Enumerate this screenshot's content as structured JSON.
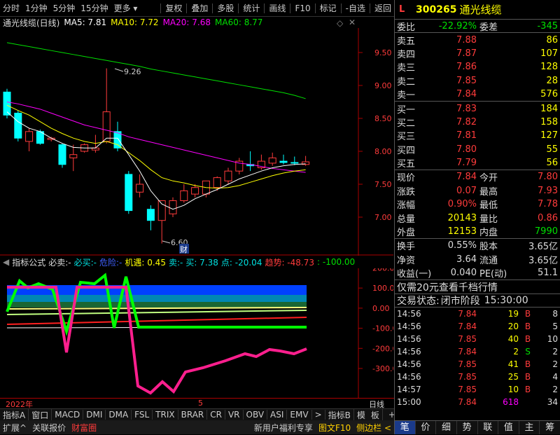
{
  "toolbar": {
    "left": [
      "分时",
      "1分钟",
      "5分钟",
      "15分钟",
      "更多"
    ],
    "right": [
      "复权",
      "叠加",
      "多股",
      "统计",
      "画线",
      "F10",
      "标记",
      "-自选",
      "返回"
    ]
  },
  "chart": {
    "title": "通光线缆(日线)",
    "ma5": "MA5: 7.81",
    "ma10": "MA10: 7.72",
    "ma20": "MA20: 7.68",
    "ma60": "MA60: 8.77",
    "high_label": "9.26",
    "low_label": "6.60",
    "cai_label": "财",
    "y_ticks": [
      "9.50",
      "9.00",
      "8.50",
      "8.00",
      "7.50",
      "7.00"
    ],
    "colors": {
      "up": "#ff3b3b",
      "down": "#00ffff",
      "ma5": "#ffffff",
      "ma10": "#ffff00",
      "ma20": "#ff00ff",
      "ma60": "#00e000"
    }
  },
  "indicator": {
    "name": "指标公式",
    "bibuy": "必卖:-",
    "bisell": "必买:-",
    "weixian": "危险:-",
    "jiyu": "机遇: 0.45",
    "mai": "卖:-",
    "mai2": "买: 7.38",
    "dian": "点: -20.04",
    "qushi": "趋势: -48.73",
    "val": ": -100.00",
    "y_ticks": [
      "200.0",
      "100.0",
      "0.00",
      "-100.0",
      "-200.0",
      "-300.0"
    ]
  },
  "date_axis": {
    "year": "2022年",
    "month": "5",
    "period": "日线"
  },
  "bottom_tabs": [
    "指标A",
    "窗口",
    "MACD",
    "DMI",
    "DMA",
    "FSL",
    "TRIX",
    "BRAR",
    "CR",
    "VR",
    "OBV",
    "ASI",
    "EMV",
    ">",
    "指标B",
    "模",
    "板",
    "+",
    "-"
  ],
  "status_left": [
    "扩展^",
    "关联报价",
    "财富圈"
  ],
  "status_right": [
    "新用户福利专享",
    "图文F10",
    "侧边栏 <"
  ],
  "quote": {
    "prefix": "L",
    "code": "300265",
    "name": "通光线缆",
    "weibi_label": "委比",
    "weibi": "-22.92%",
    "weicha_label": "委差",
    "weicha": "-345",
    "asks": [
      {
        "label": "卖五",
        "price": "7.88",
        "vol": "86"
      },
      {
        "label": "卖四",
        "price": "7.87",
        "vol": "107"
      },
      {
        "label": "卖三",
        "price": "7.86",
        "vol": "128"
      },
      {
        "label": "卖二",
        "price": "7.85",
        "vol": "28"
      },
      {
        "label": "卖一",
        "price": "7.84",
        "vol": "576"
      }
    ],
    "bids": [
      {
        "label": "买一",
        "price": "7.83",
        "vol": "184"
      },
      {
        "label": "买二",
        "price": "7.82",
        "vol": "158"
      },
      {
        "label": "买三",
        "price": "7.81",
        "vol": "127"
      },
      {
        "label": "买四",
        "price": "7.80",
        "vol": "55"
      },
      {
        "label": "买五",
        "price": "7.79",
        "vol": "56"
      }
    ],
    "stats": [
      {
        "l1": "现价",
        "v1": "7.84",
        "l2": "今开",
        "v2": "7.80"
      },
      {
        "l1": "涨跌",
        "v1": "0.07",
        "l2": "最高",
        "v2": "7.93"
      },
      {
        "l1": "涨幅",
        "v1": "0.90%",
        "l2": "最低",
        "v2": "7.78"
      },
      {
        "l1": "总量",
        "v1": "20143",
        "l2": "量比",
        "v2": "0.86"
      },
      {
        "l1": "外盘",
        "v1": "12153",
        "l2": "内盘",
        "v2": "7990"
      }
    ],
    "stats2": [
      {
        "l1": "换手",
        "v1": "0.55%",
        "l2": "股本",
        "v2": "3.65亿"
      },
      {
        "l1": "净资",
        "v1": "3.64",
        "l2": "流通",
        "v2": "3.65亿"
      },
      {
        "l1": "收益(一)",
        "v1": "0.040",
        "l2": "PE(动)",
        "v2": "51.1"
      }
    ],
    "promo": "仅需20元查看千档行情",
    "trade_status_label": "交易状态:",
    "trade_status": "闭市阶段",
    "trade_time": "15:30:00",
    "ticks": [
      {
        "t": "14:56",
        "p": "7.84",
        "v": "19",
        "s": "B",
        "n": "8"
      },
      {
        "t": "14:56",
        "p": "7.84",
        "v": "20",
        "s": "B",
        "n": "5"
      },
      {
        "t": "14:56",
        "p": "7.85",
        "v": "40",
        "s": "B",
        "n": "10"
      },
      {
        "t": "14:56",
        "p": "7.84",
        "v": "2",
        "s": "S",
        "n": "2"
      },
      {
        "t": "14:56",
        "p": "7.85",
        "v": "41",
        "s": "B",
        "n": "2"
      },
      {
        "t": "14:56",
        "p": "7.85",
        "v": "25",
        "s": "B",
        "n": "4"
      },
      {
        "t": "14:57",
        "p": "7.85",
        "v": "10",
        "s": "B",
        "n": "2"
      },
      {
        "t": "15:00",
        "p": "7.84",
        "v": "618",
        "s": "",
        "n": "34"
      }
    ],
    "bottom_nav": [
      "笔",
      "价",
      "细",
      "势",
      "联",
      "值",
      "主",
      "筹"
    ]
  }
}
